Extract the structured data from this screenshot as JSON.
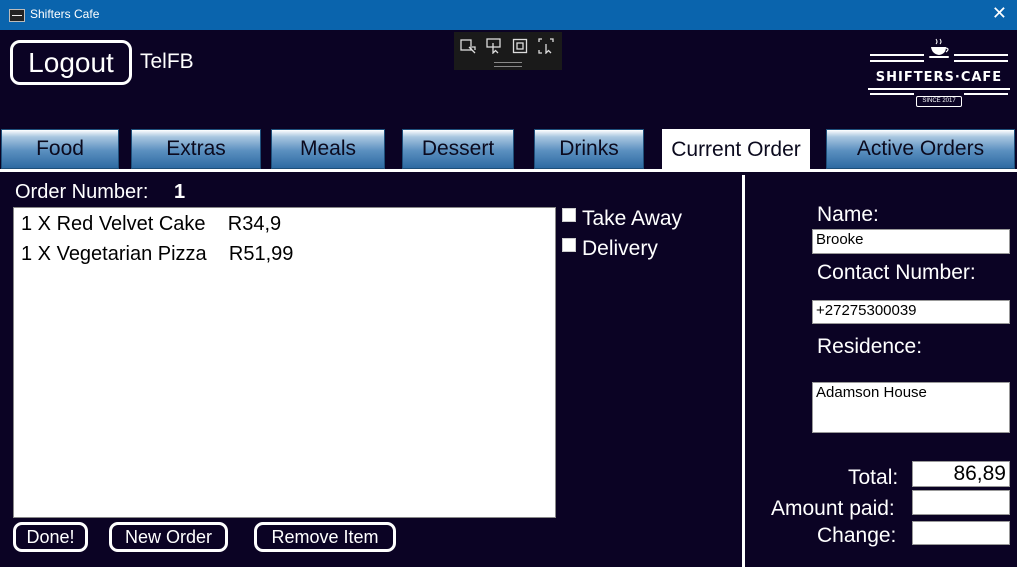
{
  "window": {
    "title": "Shifters Cafe",
    "close_glyph": "✕"
  },
  "header": {
    "logout_label": "Logout",
    "username": "TelFB"
  },
  "logo": {
    "word": "SHIFTERS·CAFE",
    "since": "SINCE 2017"
  },
  "tabs": [
    {
      "label": "Food"
    },
    {
      "label": "Extras"
    },
    {
      "label": "Meals"
    },
    {
      "label": "Dessert"
    },
    {
      "label": "Drinks"
    },
    {
      "label": "Current Order",
      "active": true
    },
    {
      "label": "Active Orders"
    }
  ],
  "order": {
    "number_label": "Order Number:",
    "number": "1",
    "items": [
      {
        "text": "1 X Red Velvet Cake    R34,9"
      },
      {
        "text": "1 X Vegetarian Pizza    R51,99"
      }
    ],
    "take_away_label": "Take Away",
    "delivery_label": "Delivery",
    "done_label": "Done!",
    "new_order_label": "New Order",
    "remove_item_label": "Remove Item"
  },
  "customer": {
    "name_label": "Name:",
    "name_value": "Brooke",
    "contact_label": "Contact Number:",
    "contact_value": "+27275300039",
    "residence_label": "Residence:",
    "residence_value": "Adamson House"
  },
  "totals": {
    "total_label": "Total:",
    "total_value": "86,89",
    "amount_paid_label": "Amount paid:",
    "amount_paid_value": "",
    "change_label": "Change:",
    "change_value": ""
  },
  "icons": {
    "app": "app-icon",
    "toolbar": [
      "add-selection-icon",
      "pointer-icon",
      "frame-icon",
      "screen-select-icon"
    ]
  },
  "colors": {
    "background": "#0b0324",
    "titlebar": "#0a64ad",
    "tab_blue": "#2e6aa2"
  }
}
